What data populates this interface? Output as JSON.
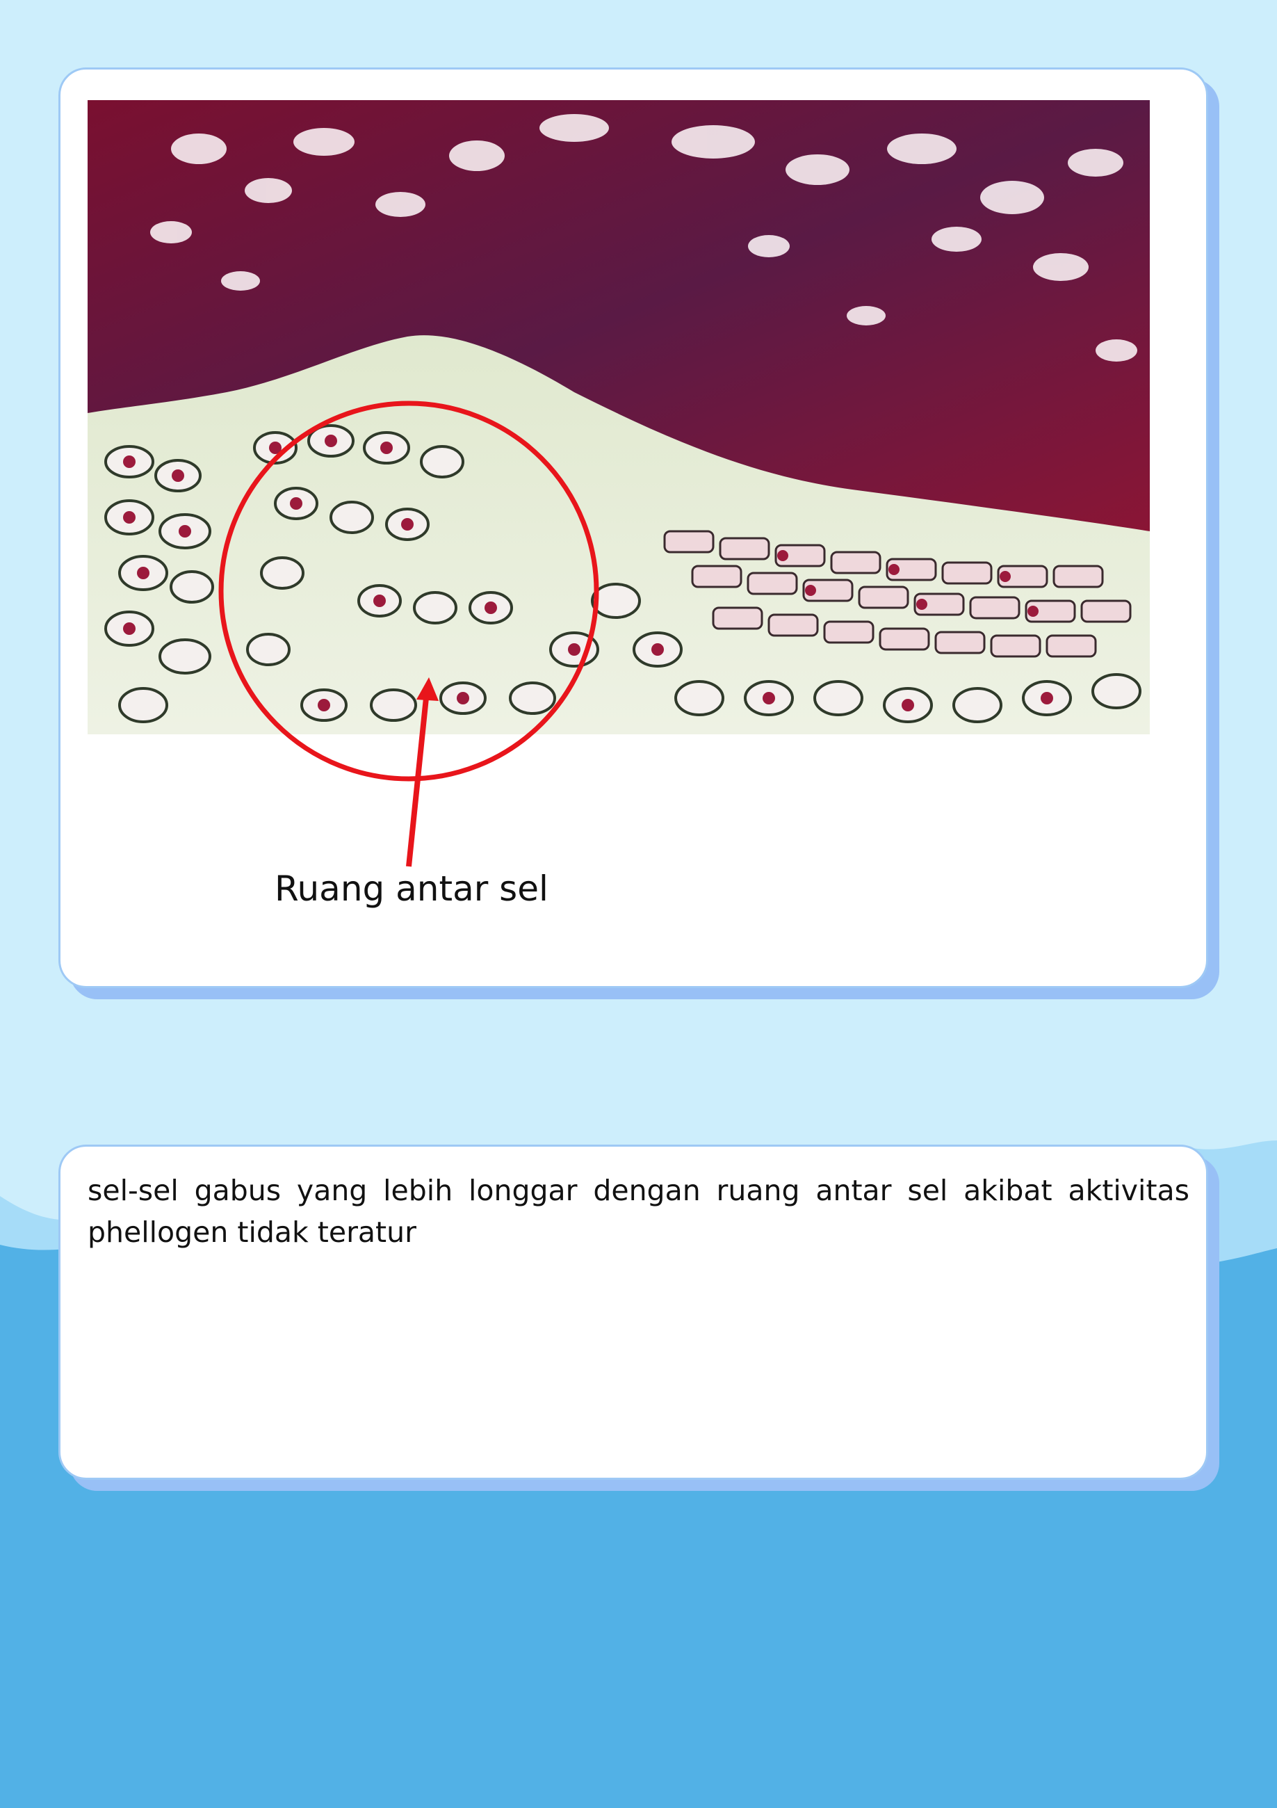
{
  "figure": {
    "image_icon": "plant-tissue-micrograph",
    "annotation_label": "Ruang antar sel",
    "annotation_color": "#e8151b"
  },
  "description": {
    "text": "sel-sel gabus yang lebih longgar dengan ruang antar sel akibat aktivitas phellogen tidak teratur"
  },
  "colors": {
    "background_light": "#cdeefc",
    "background_dark": "#52b1e6",
    "card_border": "#9ec9f5",
    "card_shadow": "#98c0f6"
  }
}
